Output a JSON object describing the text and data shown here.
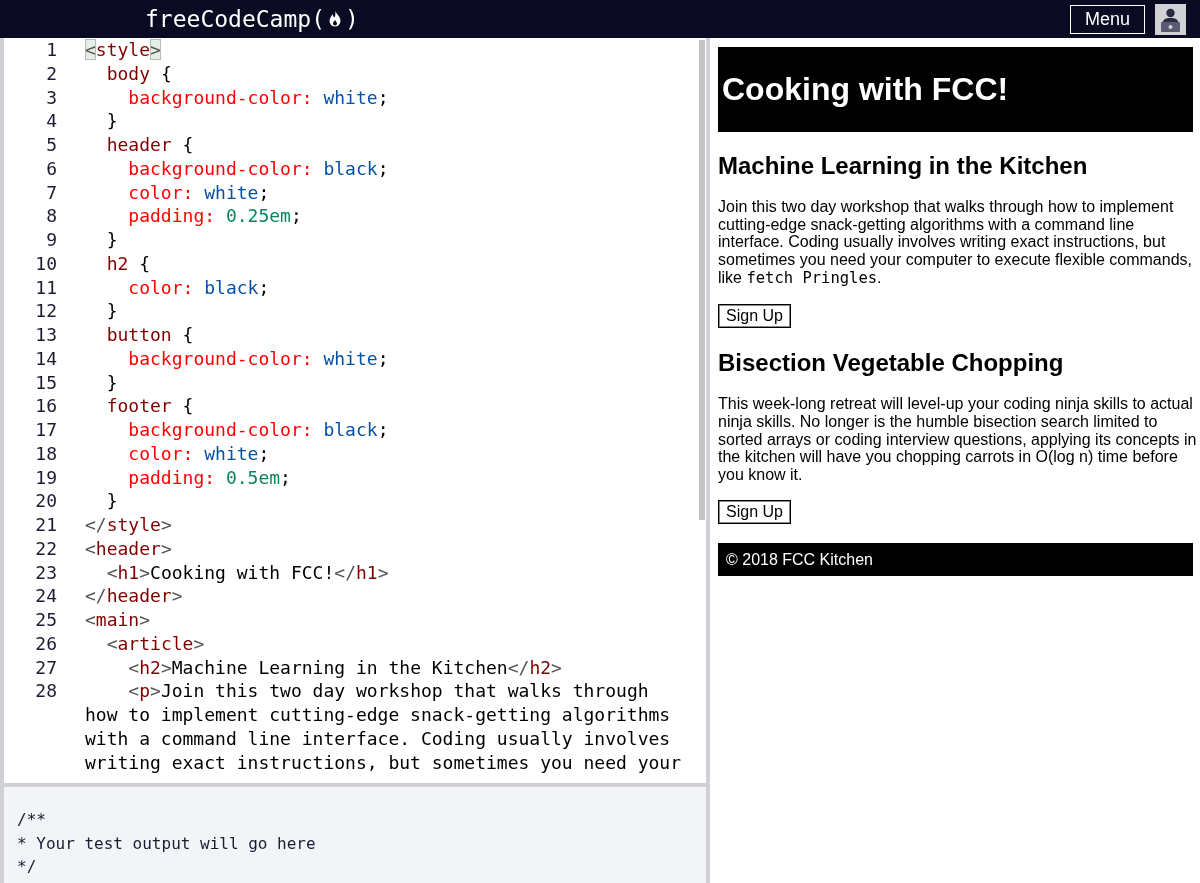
{
  "navbar": {
    "logo": {
      "text_before": "freeCodeCamp(",
      "text_after": ")"
    },
    "menu_button": "Menu"
  },
  "editor": {
    "lines": [
      {
        "number": "1",
        "tokens": [
          {
            "kind": "match",
            "text": "<"
          },
          {
            "kind": "tag",
            "text": "style"
          },
          {
            "kind": "match",
            "text": ">"
          }
        ]
      },
      {
        "number": "2",
        "tokens": [
          {
            "kind": "tag",
            "text": "  body"
          },
          {
            "kind": "plain",
            "text": " {"
          }
        ]
      },
      {
        "number": "3",
        "tokens": [
          {
            "kind": "property",
            "text": "    background-color:"
          },
          {
            "kind": "value",
            "text": " white"
          },
          {
            "kind": "plain",
            "text": ";"
          }
        ]
      },
      {
        "number": "4",
        "tokens": [
          {
            "kind": "plain",
            "text": "  }"
          }
        ]
      },
      {
        "number": "5",
        "tokens": [
          {
            "kind": "tag",
            "text": "  header"
          },
          {
            "kind": "plain",
            "text": " {"
          }
        ]
      },
      {
        "number": "6",
        "tokens": [
          {
            "kind": "property",
            "text": "    background-color:"
          },
          {
            "kind": "value",
            "text": " black"
          },
          {
            "kind": "plain",
            "text": ";"
          }
        ]
      },
      {
        "number": "7",
        "tokens": [
          {
            "kind": "property",
            "text": "    color:"
          },
          {
            "kind": "value",
            "text": " white"
          },
          {
            "kind": "plain",
            "text": ";"
          }
        ]
      },
      {
        "number": "8",
        "tokens": [
          {
            "kind": "property",
            "text": "    padding:"
          },
          {
            "kind": "number",
            "text": " 0.25em"
          },
          {
            "kind": "plain",
            "text": ";"
          }
        ]
      },
      {
        "number": "9",
        "tokens": [
          {
            "kind": "plain",
            "text": "  }"
          }
        ]
      },
      {
        "number": "10",
        "tokens": [
          {
            "kind": "tag",
            "text": "  h2"
          },
          {
            "kind": "plain",
            "text": " {"
          }
        ]
      },
      {
        "number": "11",
        "tokens": [
          {
            "kind": "property",
            "text": "    color:"
          },
          {
            "kind": "value",
            "text": " black"
          },
          {
            "kind": "plain",
            "text": ";"
          }
        ]
      },
      {
        "number": "12",
        "tokens": [
          {
            "kind": "plain",
            "text": "  }"
          }
        ]
      },
      {
        "number": "13",
        "tokens": [
          {
            "kind": "tag",
            "text": "  button"
          },
          {
            "kind": "plain",
            "text": " {"
          }
        ]
      },
      {
        "number": "14",
        "tokens": [
          {
            "kind": "property",
            "text": "    background-color:"
          },
          {
            "kind": "value",
            "text": " white"
          },
          {
            "kind": "plain",
            "text": ";"
          }
        ]
      },
      {
        "number": "15",
        "tokens": [
          {
            "kind": "plain",
            "text": "  }"
          }
        ]
      },
      {
        "number": "16",
        "tokens": [
          {
            "kind": "tag",
            "text": "  footer"
          },
          {
            "kind": "plain",
            "text": " {"
          }
        ]
      },
      {
        "number": "17",
        "tokens": [
          {
            "kind": "property",
            "text": "    background-color:"
          },
          {
            "kind": "value",
            "text": " black"
          },
          {
            "kind": "plain",
            "text": ";"
          }
        ]
      },
      {
        "number": "18",
        "tokens": [
          {
            "kind": "property",
            "text": "    color:"
          },
          {
            "kind": "value",
            "text": " white"
          },
          {
            "kind": "plain",
            "text": ";"
          }
        ]
      },
      {
        "number": "19",
        "tokens": [
          {
            "kind": "property",
            "text": "    padding:"
          },
          {
            "kind": "number",
            "text": " 0.5em"
          },
          {
            "kind": "plain",
            "text": ";"
          }
        ]
      },
      {
        "number": "20",
        "tokens": [
          {
            "kind": "plain",
            "text": "  }"
          }
        ]
      },
      {
        "number": "21",
        "tokens": [
          {
            "kind": "delim",
            "text": "</"
          },
          {
            "kind": "tag",
            "text": "style"
          },
          {
            "kind": "delim",
            "text": ">"
          }
        ]
      },
      {
        "number": "22",
        "tokens": [
          {
            "kind": "delim",
            "text": "<"
          },
          {
            "kind": "tag",
            "text": "header"
          },
          {
            "kind": "delim",
            "text": ">"
          }
        ]
      },
      {
        "number": "23",
        "tokens": [
          {
            "kind": "delim",
            "text": "  <"
          },
          {
            "kind": "tag",
            "text": "h1"
          },
          {
            "kind": "delim",
            "text": ">"
          },
          {
            "kind": "plain",
            "text": "Cooking with FCC!"
          },
          {
            "kind": "delim",
            "text": "</"
          },
          {
            "kind": "tag",
            "text": "h1"
          },
          {
            "kind": "delim",
            "text": ">"
          }
        ]
      },
      {
        "number": "24",
        "tokens": [
          {
            "kind": "delim",
            "text": "</"
          },
          {
            "kind": "tag",
            "text": "header"
          },
          {
            "kind": "delim",
            "text": ">"
          }
        ]
      },
      {
        "number": "25",
        "tokens": [
          {
            "kind": "delim",
            "text": "<"
          },
          {
            "kind": "tag",
            "text": "main"
          },
          {
            "kind": "delim",
            "text": ">"
          }
        ]
      },
      {
        "number": "26",
        "tokens": [
          {
            "kind": "delim",
            "text": "  <"
          },
          {
            "kind": "tag",
            "text": "article"
          },
          {
            "kind": "delim",
            "text": ">"
          }
        ]
      },
      {
        "number": "27",
        "tokens": [
          {
            "kind": "delim",
            "text": "    <"
          },
          {
            "kind": "tag",
            "text": "h2"
          },
          {
            "kind": "delim",
            "text": ">"
          },
          {
            "kind": "plain",
            "text": "Machine Learning in the Kitchen"
          },
          {
            "kind": "delim",
            "text": "</"
          },
          {
            "kind": "tag",
            "text": "h2"
          },
          {
            "kind": "delim",
            "text": ">"
          }
        ]
      },
      {
        "number": "28",
        "tokens": [
          {
            "kind": "delim",
            "text": "    <"
          },
          {
            "kind": "tag",
            "text": "p"
          },
          {
            "kind": "delim",
            "text": ">"
          },
          {
            "kind": "plain",
            "text": "Join this two day workshop that walks through how to implement cutting-edge snack-getting algorithms with a command line interface. Coding usually involves writing exact instructions, but sometimes you need your"
          }
        ]
      }
    ]
  },
  "test_output": {
    "lines": [
      "/**",
      "* Your test output will go here",
      "*/"
    ]
  },
  "preview": {
    "header_title": "Cooking with FCC!",
    "articles": [
      {
        "title": "Machine Learning in the Kitchen",
        "paragraph": [
          {
            "kind": "text",
            "text": "Join this two day workshop that walks through how to implement cutting-edge snack-getting algorithms with a command line interface. Coding usually involves writing exact instructions, but sometimes you need your computer to execute flexible commands, like "
          },
          {
            "kind": "code",
            "text": "fetch Pringles"
          },
          {
            "kind": "text",
            "text": "."
          }
        ],
        "button": "Sign Up"
      },
      {
        "title": "Bisection Vegetable Chopping",
        "paragraph": [
          {
            "kind": "text",
            "text": "This week-long retreat will level-up your coding ninja skills to actual ninja skills. No longer is the humble bisection search limited to sorted arrays or coding interview questions, applying its concepts in the kitchen will have you chopping carrots in O(log n) time before you know it."
          }
        ],
        "button": "Sign Up"
      }
    ],
    "footer": "© 2018 FCC Kitchen"
  }
}
